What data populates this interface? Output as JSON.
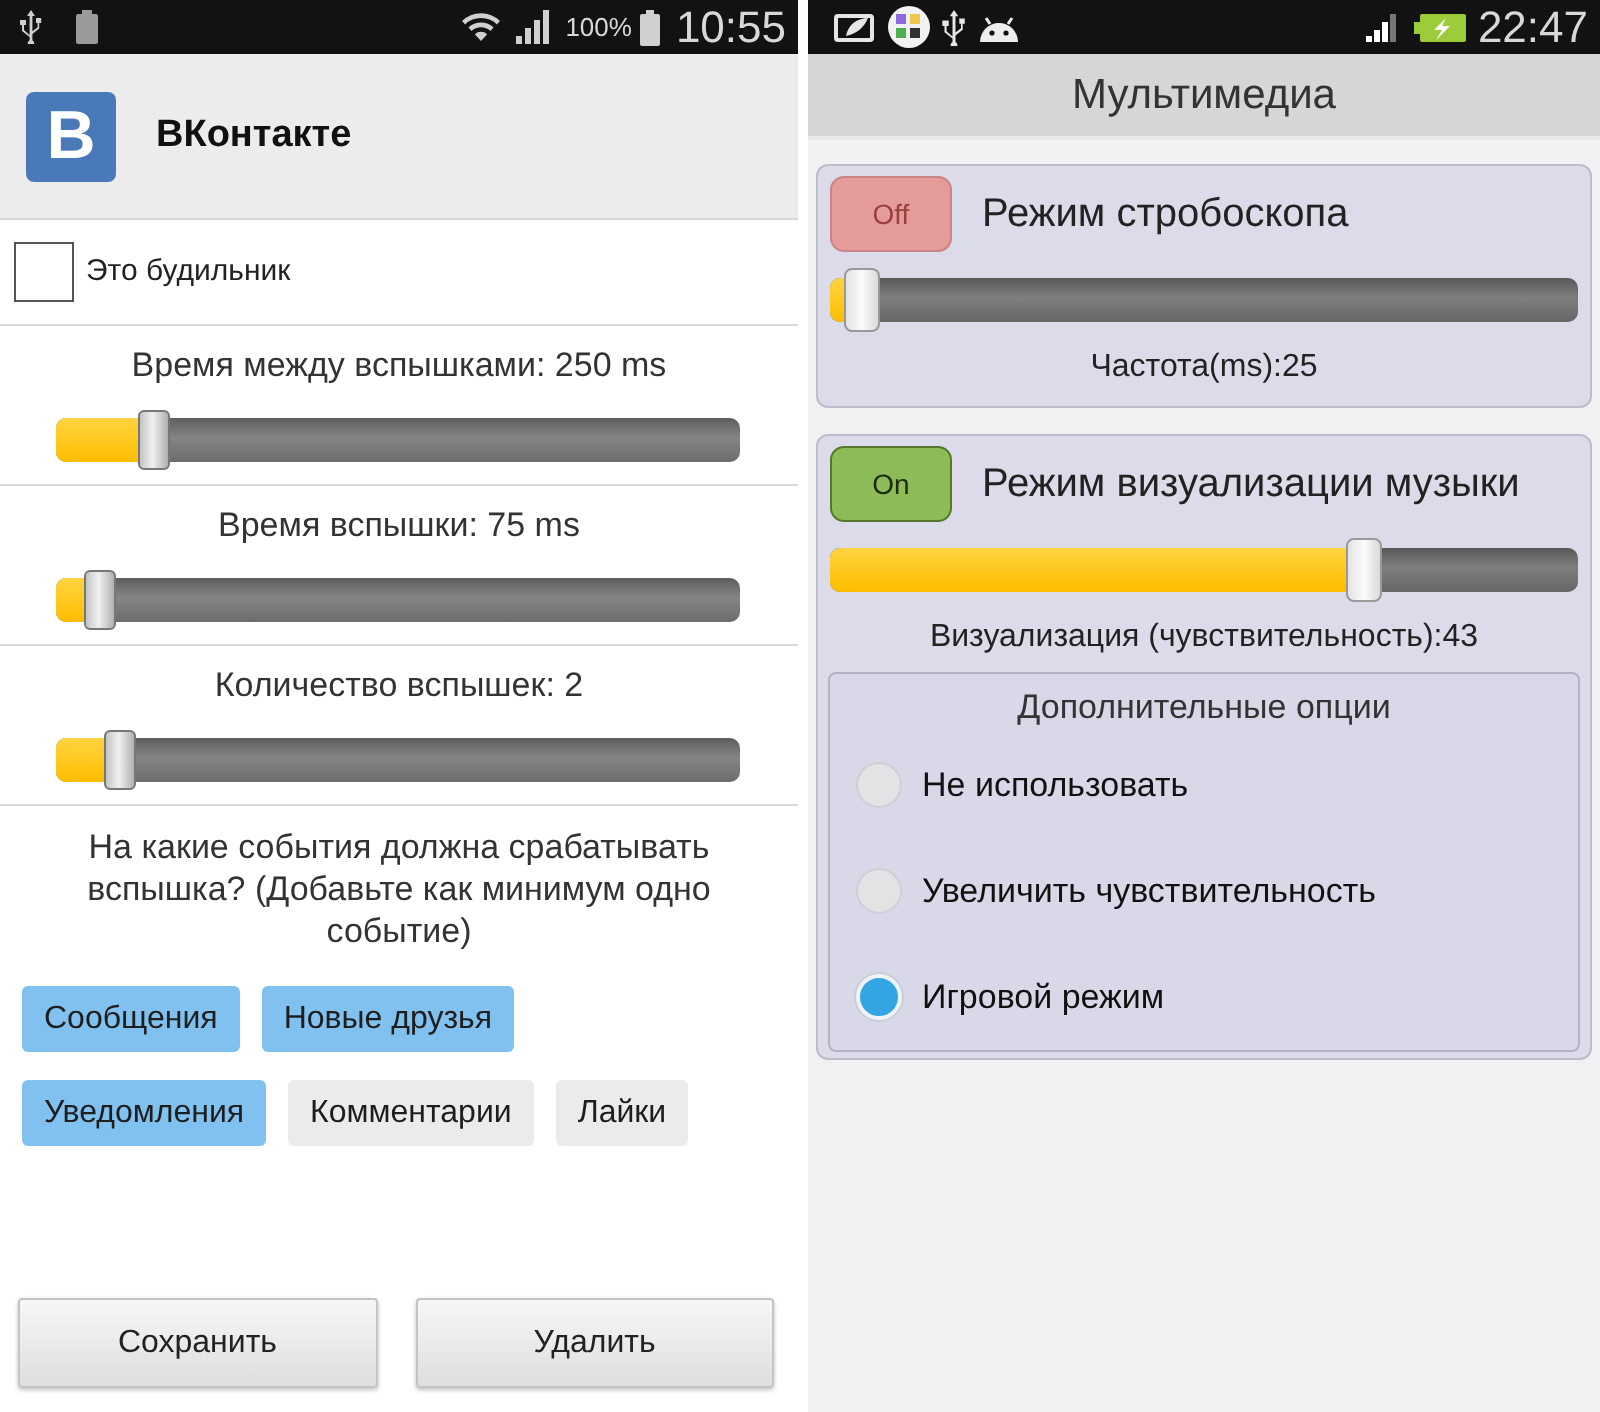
{
  "left_screen": {
    "status_bar": {
      "battery_percent": "100%",
      "time": "10:55"
    },
    "app_bar": {
      "logo": "B",
      "title": "ВКонтакте"
    },
    "alarm": {
      "label": "Это будильник",
      "checked": false
    },
    "sliders": [
      {
        "label": "Время между вспышками: 250 ms",
        "level": 0.12
      },
      {
        "label": "Время вспышки: 75 ms",
        "level": 0.04
      },
      {
        "label": "Количество вспышек: 2",
        "level": 0.07
      }
    ],
    "events": {
      "prompt": "На какие события должна срабатывать вспышка? (Добавьте как минимум одно событие)",
      "tag_rows": [
        [
          {
            "label": "Сообщения",
            "selected": true
          },
          {
            "label": "Новые друзья",
            "selected": true
          }
        ],
        [
          {
            "label": "Уведомления",
            "selected": true
          },
          {
            "label": "Комментарии",
            "selected": false
          },
          {
            "label": "Лайки",
            "selected": false
          }
        ]
      ]
    },
    "buttons": [
      "Сохранить",
      "Удалить"
    ]
  },
  "right_screen": {
    "status_bar": {
      "time": "22:47"
    },
    "title": "Мультимедиа",
    "modes": [
      {
        "toggle": "Off",
        "on": false,
        "title": "Режим стробоскопа",
        "level": 0.02,
        "reading": "Частота(ms):25"
      },
      {
        "toggle": "On",
        "on": true,
        "title": "Режим визуализации музыки",
        "level": 0.69,
        "reading": "Визуализация (чувствительность):43",
        "options": {
          "title": "Дополнительные опции",
          "choices": [
            {
              "label": "Не использовать",
              "selected": false
            },
            {
              "label": "Увеличить чувствительность",
              "selected": false
            },
            {
              "label": "Игровой режим",
              "selected": true
            }
          ]
        }
      }
    ]
  }
}
